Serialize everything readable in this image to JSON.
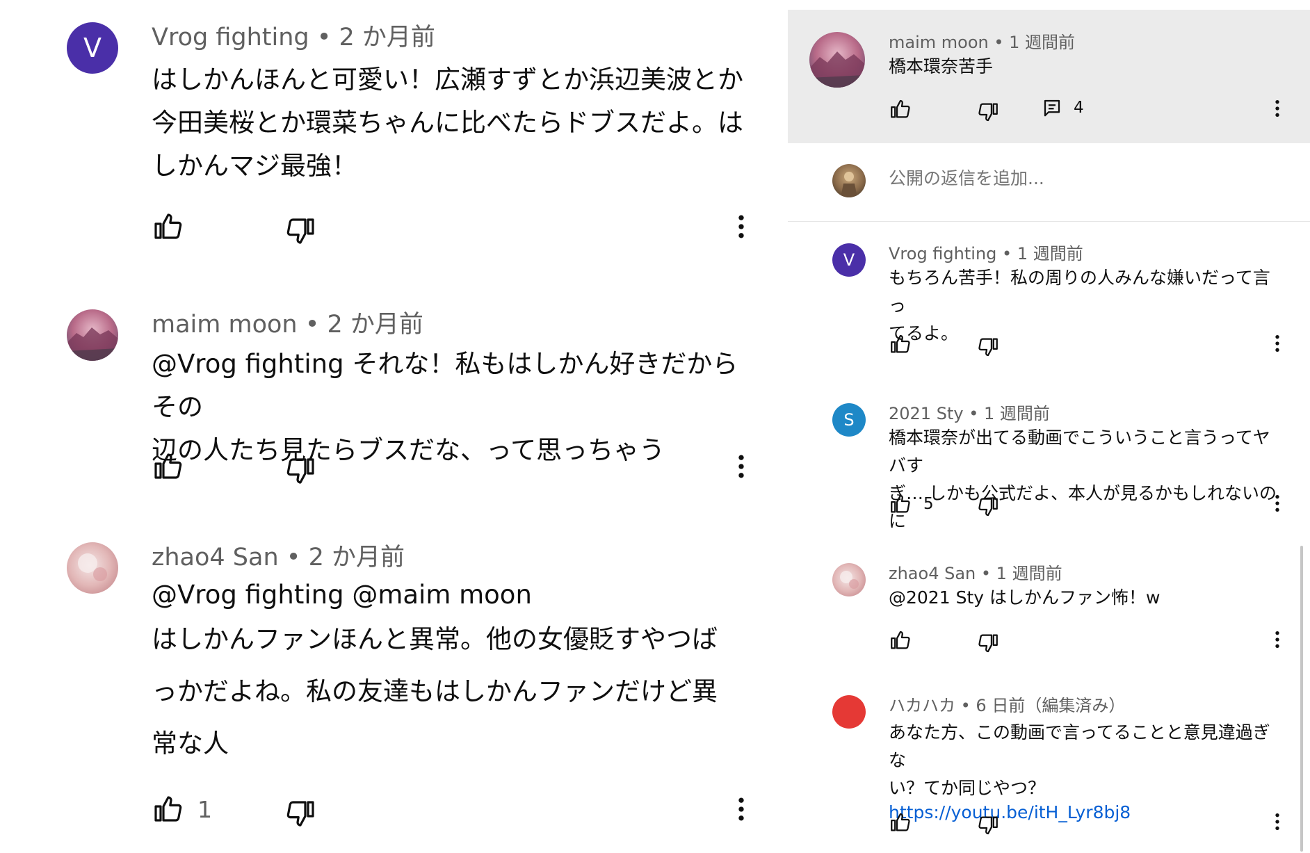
{
  "colors": {
    "avatar_v": "#4a2fa8",
    "avatar_s": "#1e88c7",
    "avatar_hakahaka": "#e53935",
    "link": "#065fd4",
    "meta_text": "#606060",
    "highlight_panel": "#ebebeb"
  },
  "left": {
    "comments": [
      {
        "avatar_letter": "V",
        "author": "Vrog fighting",
        "time": "2 か月前",
        "lines": [
          "はしかんほんと可愛い！広瀬すずとか浜辺美波とか",
          "今田美桜とか環菜ちゃんに比べたらドブスだよ。は",
          "しかんマジ最強！"
        ],
        "like_count": ""
      },
      {
        "avatar_letter": "",
        "author": "maim moon",
        "time": "2 か月前",
        "lines": [
          "@Vrog fighting それな！私もはしかん好きだからその",
          "辺の人たち見たらブスだな、って思っちゃう"
        ],
        "like_count": ""
      },
      {
        "avatar_letter": "",
        "author": "zhao4 San",
        "time": "2 か月前",
        "mention_line": "@Vrog fighting @maim moon",
        "lines": [
          "はしかんファンほんと異常。他の女優貶すやつば",
          "っかだよね。私の友達もはしかんファンだけど異",
          "常な人"
        ],
        "like_count": "1"
      }
    ]
  },
  "right": {
    "parent": {
      "author": "maim moon",
      "time": "1 週間前",
      "text": "橋本環奈苦手",
      "like_count": "",
      "reply_count": "4"
    },
    "reply_placeholder": "公開の返信を追加...",
    "replies": [
      {
        "avatar_letter": "V",
        "author": "Vrog fighting",
        "time": "1 週間前",
        "lines": [
          "もちろん苦手！私の周りの人みんな嫌いだって言っ",
          "てるよ。"
        ],
        "like_count": ""
      },
      {
        "avatar_letter": "S",
        "author": "2021 Sty",
        "time": "1 週間前",
        "lines": [
          "橋本環奈が出てる動画でこういうこと言うってヤバす",
          "ぎ… しかも公式だよ、本人が見るかもしれないのに"
        ],
        "like_count": "5"
      },
      {
        "avatar_letter": "",
        "author": "zhao4 San",
        "time": "1 週間前",
        "lines": [
          "@2021 Sty はしかんファン怖！w"
        ],
        "like_count": ""
      },
      {
        "avatar_letter": "",
        "author": "ハカハカ",
        "time": "6 日前（編集済み）",
        "lines": [
          "あなた方、この動画で言ってることと意見違過ぎな",
          "い？てか同じやつ？"
        ],
        "link": "https://youtu.be/itH_Lyr8bj8",
        "like_count": ""
      }
    ]
  },
  "separator": " • "
}
